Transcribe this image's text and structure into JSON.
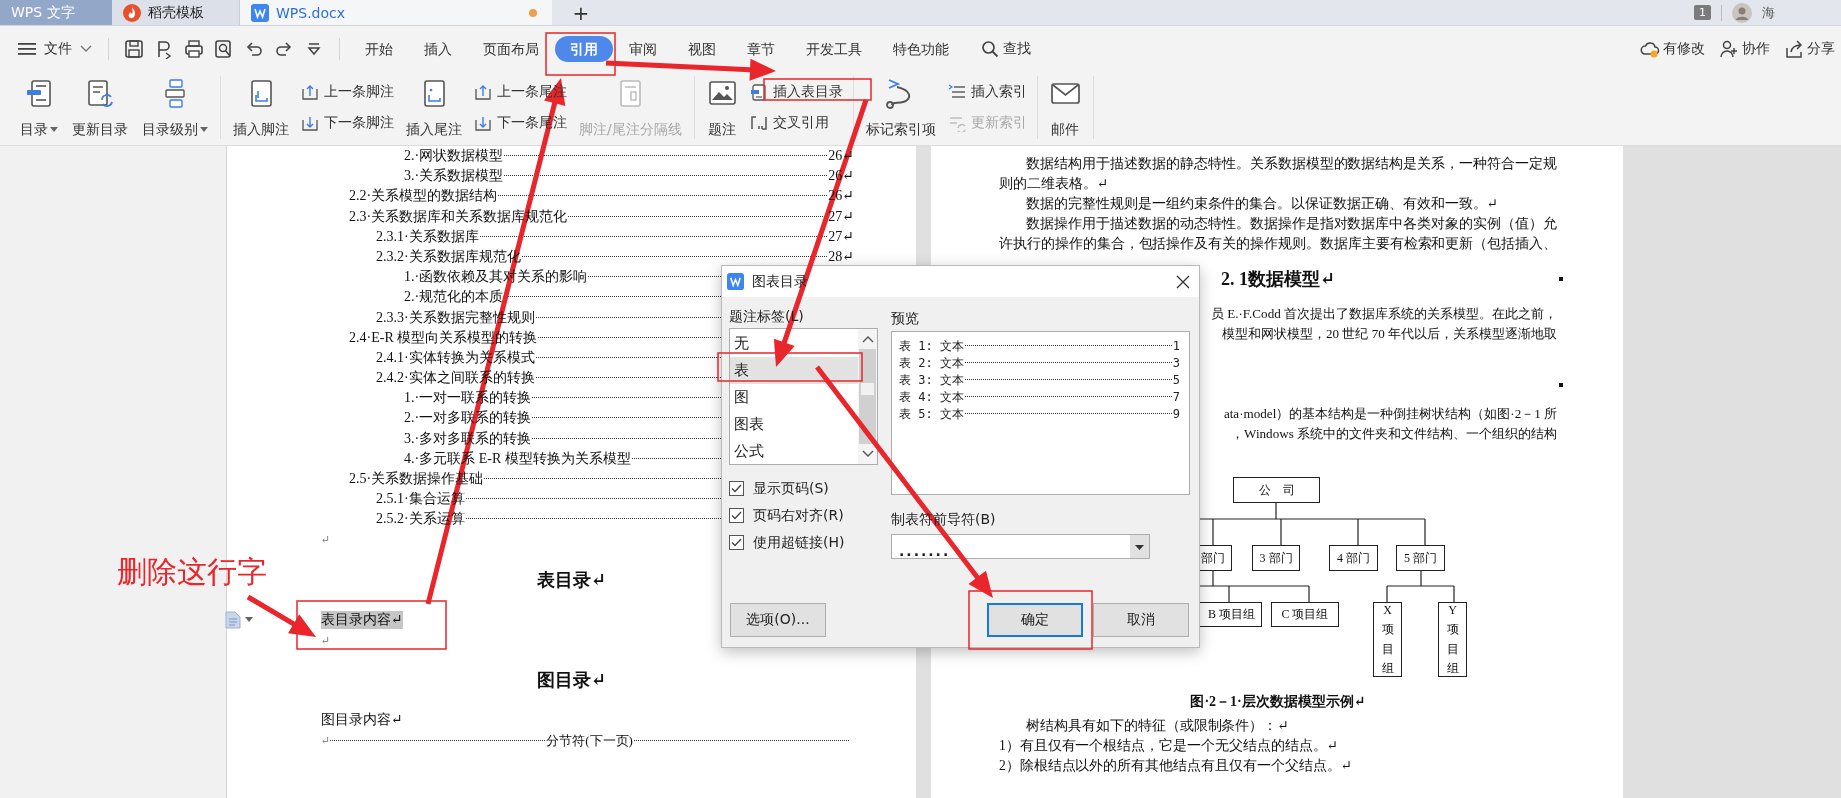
{
  "app_tabs": [
    {
      "kind": "app",
      "label": "WPS 文字",
      "selected": false,
      "modified": false
    },
    {
      "kind": "docer",
      "label": "稻壳模板",
      "selected": false,
      "modified": false
    },
    {
      "kind": "document",
      "label": "WPS.docx",
      "selected": true,
      "modified": true
    }
  ],
  "new_tab": "+",
  "account": {
    "badge": "1",
    "user": "海"
  },
  "menu": {
    "file": "文件",
    "tabs": [
      {
        "label": "开始",
        "selected": false
      },
      {
        "label": "插入",
        "selected": false
      },
      {
        "label": "页面布局",
        "selected": false
      },
      {
        "label": "引用",
        "selected": true
      },
      {
        "label": "审阅",
        "selected": false
      },
      {
        "label": "视图",
        "selected": false
      },
      {
        "label": "章节",
        "selected": false
      },
      {
        "label": "开发工具",
        "selected": false
      },
      {
        "label": "特色功能",
        "selected": false
      }
    ],
    "search": "查找",
    "actions": [
      {
        "kind": "changes",
        "label": "有修改"
      },
      {
        "kind": "collab",
        "label": "协作"
      },
      {
        "kind": "share",
        "label": "分享"
      }
    ]
  },
  "ribbon": [
    [
      {
        "kind": "large",
        "label": "目录",
        "dropdown": true,
        "disabled": false
      },
      {
        "kind": "large",
        "label": "更新目录",
        "dropdown": false,
        "disabled": false
      },
      {
        "kind": "large",
        "label": "目录级别",
        "dropdown": true,
        "disabled": false
      }
    ],
    [
      {
        "kind": "large",
        "label": "插入脚注",
        "dropdown": false,
        "disabled": false
      },
      {
        "kind": "small",
        "label": "上一条脚注",
        "dropdown": false,
        "disabled": false
      },
      {
        "kind": "small",
        "label": "下一条脚注",
        "dropdown": false,
        "disabled": false
      },
      {
        "kind": "large",
        "label": "插入尾注",
        "dropdown": false,
        "disabled": false
      },
      {
        "kind": "small",
        "label": "上一条尾注",
        "dropdown": false,
        "disabled": false
      },
      {
        "kind": "small",
        "label": "下一条尾注",
        "dropdown": false,
        "disabled": false
      },
      {
        "kind": "large",
        "label": "脚注/尾注分隔线",
        "dropdown": false,
        "disabled": true
      }
    ],
    [
      {
        "kind": "large",
        "label": "题注",
        "dropdown": false,
        "disabled": false
      },
      {
        "kind": "small",
        "label": "插入表目录",
        "dropdown": false,
        "disabled": false
      },
      {
        "kind": "small",
        "label": "交叉引用",
        "dropdown": false,
        "disabled": false
      }
    ],
    [
      {
        "kind": "large",
        "label": "标记索引项",
        "dropdown": false,
        "disabled": false
      },
      {
        "kind": "small",
        "label": "插入索引",
        "dropdown": false,
        "disabled": false
      },
      {
        "kind": "small",
        "label": "更新索引",
        "dropdown": false,
        "disabled": true
      }
    ],
    [
      {
        "kind": "large",
        "label": "邮件",
        "dropdown": false,
        "disabled": false
      }
    ]
  ],
  "left_page": {
    "toc": [
      {
        "children": [
          {
            "children": [
              {
                "text": "2.·网状数据模型",
                "page": "26↵"
              },
              {
                "text": "3.·关系数据模型",
                "page": "26↵"
              }
            ]
          }
        ]
      },
      {
        "text": "2.2·关系模型的数据结构",
        "page": "26↵"
      },
      {
        "text": "2.3·关系数据库和关系数据库规范化",
        "page": "27↵",
        "children": [
          {
            "text": "2.3.1·关系数据库",
            "page": "27↵"
          },
          {
            "text": "2.3.2·关系数据库规范化",
            "page": "28↵",
            "children": [
              {
                "text": "1.·函数依赖及其对关系的影响"
              },
              {
                "text": "2.·规范化的本质"
              }
            ]
          },
          {
            "text": "2.3.3·关系数据完整性规则"
          }
        ]
      },
      {
        "text": "2.4·E-R 模型向关系模型的转换",
        "children": [
          {
            "text": "2.4.1·实体转换为关系模式"
          },
          {
            "text": "2.4.2·实体之间联系的转换",
            "children": [
              {
                "text": "1.·一对一联系的转换"
              },
              {
                "text": "2.·一对多联系的转换"
              },
              {
                "text": "3.·多对多联系的转换"
              },
              {
                "text": "4.·多元联系 E-R 模型转换为关系模型"
              }
            ]
          }
        ]
      },
      {
        "text": "2.5·关系数据操作基础",
        "children": [
          {
            "text": "2.5.1·集合运算"
          },
          {
            "text": "2.5.2·关系运算"
          }
        ]
      }
    ],
    "blocks": [
      {
        "kind": "mark",
        "text": "↵"
      },
      {
        "kind": "heading",
        "text": "表目录↵"
      },
      {
        "kind": "para",
        "text": "表目录内容↵",
        "selected": true,
        "handle": true
      },
      {
        "kind": "mark",
        "text": "↵"
      },
      {
        "kind": "heading",
        "text": "图目录↵"
      },
      {
        "kind": "para",
        "text": "图目录内容↵",
        "selected": false,
        "handle": false
      },
      {
        "kind": "section_break",
        "mark": "↵",
        "text": "分节符(下一页)"
      }
    ]
  },
  "right_page": [
    {
      "kind": "para",
      "text": "数据结构用于描述数据的静态特性。关系数据模型的数据结构是关系，一种符合一定规则的二维表格。↵"
    },
    {
      "kind": "para",
      "text": "数据的完整性规则是一组约束条件的集合。以保证数据正确、有效和一致。↵"
    },
    {
      "kind": "para",
      "text": "数据操作用于描述数据的动态特性。数据操作是指对数据库中各类对象的实例（值）允许执行的操作的集合，包括操作及有关的操作规则。数据库主要有检索和更新（包括插入、"
    },
    {
      "kind": "heading",
      "text": "2. 1数据模型↵",
      "marker": true
    },
    {
      "kind": "clipped",
      "text": "员 E.·F.Codd 首次提出了数据库系统的关系模型。在此之前，"
    },
    {
      "kind": "clipped",
      "text": "模型和网状模型，20 世纪 70 年代以后，关系模型逐渐地取"
    },
    {
      "kind": "marker"
    },
    {
      "kind": "clipped",
      "text": "ata·model）的基本结构是一种倒挂树状结构（如图·2－1 所"
    },
    {
      "kind": "clipped",
      "text": "，Windows 系统中的文件夹和文件结构、一个组织的结构"
    },
    {
      "kind": "diagram",
      "nodes": [
        {
          "kind": "box",
          "text": "公　司"
        },
        {
          "kind": "box",
          "text": "部门"
        },
        {
          "kind": "box",
          "text": "3 部门"
        },
        {
          "kind": "box",
          "text": "4 部门"
        },
        {
          "kind": "box",
          "text": "5 部门"
        },
        {
          "kind": "box",
          "text": "B 项目组"
        },
        {
          "kind": "box",
          "text": "C 项目组"
        },
        {
          "kind": "vertical",
          "text": "X项目组"
        },
        {
          "kind": "vertical",
          "text": "Y项目组"
        }
      ]
    },
    {
      "kind": "caption",
      "text": "图·2－1·层次数据模型示例↵"
    },
    {
      "kind": "para",
      "text": "树结构具有如下的特征（或限制条件）：↵"
    },
    {
      "kind": "plain",
      "text": "1）有且仅有一个根结点，它是一个无父结点的结点。↵"
    },
    {
      "kind": "plain",
      "text": "2）除根结点以外的所有其他结点有且仅有一个父结点。↵"
    }
  ],
  "dialog": {
    "title": "图表目录",
    "caption_label": "题注标签(L)",
    "captions": [
      {
        "label": "无",
        "selected": false
      },
      {
        "label": "表",
        "selected": true
      },
      {
        "label": "图",
        "selected": false
      },
      {
        "label": "图表",
        "selected": false
      },
      {
        "label": "公式",
        "selected": false
      }
    ],
    "options": [
      {
        "label": "显示页码(S)",
        "checked": true
      },
      {
        "label": "页码右对齐(R)",
        "checked": true
      },
      {
        "label": "使用超链接(H)",
        "checked": true
      }
    ],
    "preview_label": "预览",
    "preview": [
      {
        "label": "表 1: 文本",
        "page": "1"
      },
      {
        "label": "表 2: 文本",
        "page": "3"
      },
      {
        "label": "表 3: 文本",
        "page": "5"
      },
      {
        "label": "表 4: 文本",
        "page": "7"
      },
      {
        "label": "表 5: 文本",
        "page": "9"
      }
    ],
    "leader_label": "制表符前导符(B)",
    "leader_value": ".......",
    "buttons": [
      {
        "kind": "options",
        "label": "选项(O)...",
        "default": false
      },
      {
        "kind": "ok",
        "label": "确定",
        "default": true
      },
      {
        "kind": "cancel",
        "label": "取消",
        "default": false
      }
    ]
  },
  "annotation": {
    "note": "删除这行字"
  }
}
